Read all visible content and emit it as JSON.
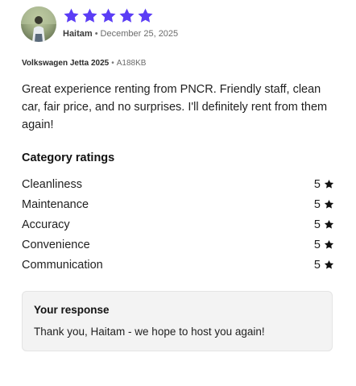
{
  "reviewer": {
    "name": "Haitam",
    "date": "December 25, 2025",
    "separator": "•",
    "overall_rating": 5,
    "star_color": "#5b3df5"
  },
  "vehicle": {
    "model": "Volkswagen Jetta 2025",
    "separator": "•",
    "plate": "A188KB"
  },
  "review": {
    "text": "Great experience renting from PNCR. Friendly staff, clean car, fair price, and no surprises. I'll definitely rent from them again!"
  },
  "category_ratings": {
    "title": "Category ratings",
    "items": [
      {
        "label": "Cleanliness",
        "value": "5"
      },
      {
        "label": "Maintenance",
        "value": "5"
      },
      {
        "label": "Accuracy",
        "value": "5"
      },
      {
        "label": "Convenience",
        "value": "5"
      },
      {
        "label": "Communication",
        "value": "5"
      }
    ]
  },
  "response": {
    "title": "Your response",
    "text": "Thank you, Haitam - we hope to host you again!"
  },
  "icons": {
    "rating_star": "star-icon",
    "category_star": "star-icon"
  }
}
